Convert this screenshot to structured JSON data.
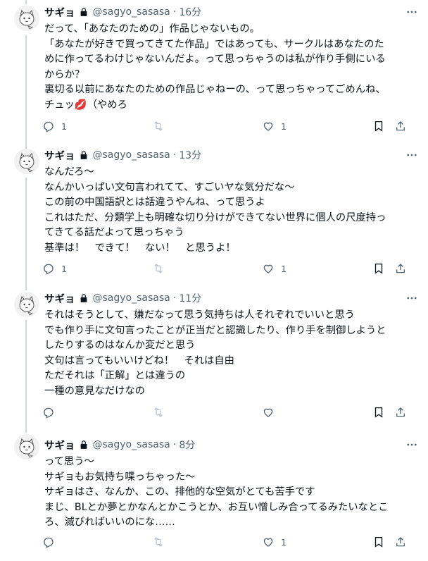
{
  "tweets": [
    {
      "name": "サギョ",
      "handle": "@sagyo_sasasa",
      "time": "16分",
      "lines": [
        "だって、「あなたのための」作品じゃないもの。",
        "「あなたが好きで買ってきてた作品」ではあっても、サークルはあなたのた",
        "めに作ってるわけじゃないんだよ。って思っちゃうのは私が作り手側にいる",
        "からか？",
        "裏切る以前にあなたのための作品じゃねーの、って思っちゃってごめんね、",
        "チュッ💋（やめろ"
      ],
      "reply_count": "1",
      "retweet_count": "",
      "like_count": "1"
    },
    {
      "name": "サギョ",
      "handle": "@sagyo_sasasa",
      "time": "13分",
      "lines": [
        "なんだろ～",
        "なんかいっぱい文句言われてて、すごいヤな気分だな～",
        "この前の中国語訳とは話違うやんね、って思うよ",
        "これはただ、分類学上も明確な切り分けができてない世界に個人の尺度持っ",
        "てきてる話だよって思っちゃう",
        "基準は！　できて！　ない！　と思うよ！"
      ],
      "reply_count": "1",
      "retweet_count": "",
      "like_count": "1"
    },
    {
      "name": "サギョ",
      "handle": "@sagyo_sasasa",
      "time": "11分",
      "lines": [
        "それはそうとして、嫌だなって思う気持ちは人それぞれでいいと思う",
        "でも作り手に文句言ったことが正当だと認識したり、作り手を制御しようと",
        "したりするのはなんか変だと思う",
        "文句は言ってもいいけどね！　それは自由",
        "ただそれは「正解」とは違うの",
        "一種の意見なだけなの"
      ],
      "reply_count": "",
      "retweet_count": "",
      "like_count": ""
    },
    {
      "name": "サギョ",
      "handle": "@sagyo_sasasa",
      "time": "8分",
      "lines": [
        "って思う～",
        "サギョもお気持ち喋っちゃった～",
        "サギョはさ、なんか、この、排他的な空気がとても苦手です",
        "まじ、BLとか夢とかなんとかこうとか、お互い憎しみ合ってるみたいなとこ",
        "ろ、滅びればいいのにな……"
      ],
      "reply_count": "",
      "retweet_count": "",
      "like_count": "1"
    }
  ],
  "icons": {
    "lock": "lock-icon",
    "more": "more-icon",
    "reply": "reply-icon",
    "retweet": "retweet-icon",
    "like": "like-icon",
    "bookmark": "bookmark-icon",
    "share": "share-icon"
  },
  "colors": {
    "text": "#0f1419",
    "muted": "#536471",
    "thread_line": "#cfd9de"
  }
}
